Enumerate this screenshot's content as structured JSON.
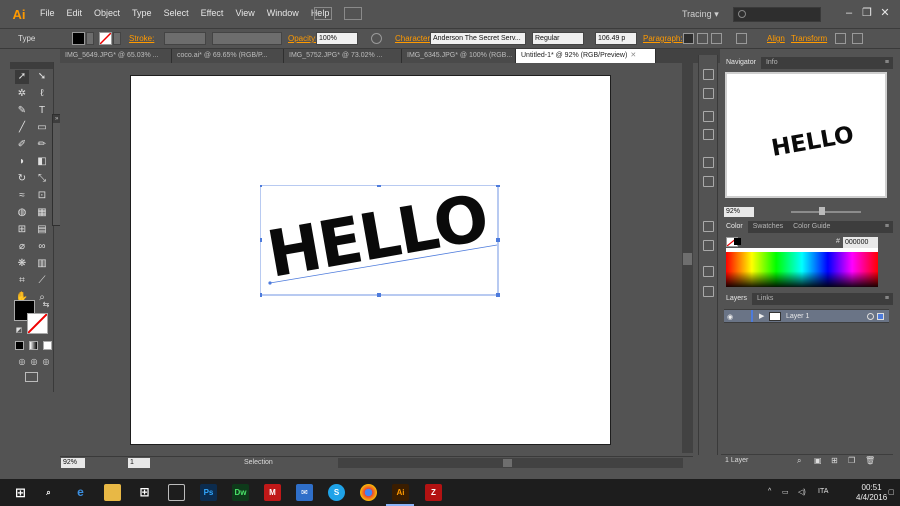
{
  "app": {
    "logo": "Ai"
  },
  "menu": [
    "File",
    "Edit",
    "Object",
    "Type",
    "Select",
    "Effect",
    "View",
    "Window",
    "Help"
  ],
  "workspace": {
    "label": "Tracing",
    "caret": "▾",
    "search_placeholder": ""
  },
  "window_controls": {
    "minimize": "–",
    "maximize": "❐",
    "close": "✕"
  },
  "control_bar": {
    "mode": "Type",
    "stroke_label": "Stroke:",
    "opacity_label": "Opacity:",
    "opacity_value": "100%",
    "character_label": "Character:",
    "font_name": "Anderson The Secret Serv...",
    "font_style": "Regular",
    "font_size": "106.49 p",
    "paragraph_label": "Paragraph:",
    "align_label": "Align",
    "transform_label": "Transform"
  },
  "tabs": [
    {
      "label": "IMG_5649.JPG* @ 65.03% ...",
      "active": false
    },
    {
      "label": "coco.ai* @ 69.65% (RGB/P...",
      "active": false
    },
    {
      "label": "IMG_5752.JPG* @ 73.02% ...",
      "active": false
    },
    {
      "label": "IMG_6345.JPG* @ 100% (RGB...",
      "active": false
    },
    {
      "label": "Untitled-1* @ 92% (RGB/Preview)",
      "active": true
    }
  ],
  "artwork": {
    "text": "HΕLLO",
    "color": "#0a0a0a"
  },
  "status": {
    "zoom": "92%",
    "page": "1",
    "tool": "Selection"
  },
  "navigator": {
    "tabs": [
      "Navigator",
      "Info"
    ],
    "zoom": "92%",
    "preview_text": "HΕLLO"
  },
  "color_panel": {
    "tabs": [
      "Color",
      "Swatches",
      "Color Guide"
    ],
    "hex_prefix": "#",
    "hex": "000000"
  },
  "layers_panel": {
    "tabs": [
      "Layers",
      "Links"
    ],
    "layer_name": "Layer 1",
    "count": "1 Layer"
  },
  "taskbar": {
    "language": "ITA",
    "time": "00:51",
    "date": "4/4/2016",
    "icons": [
      "windows-icon",
      "search-icon",
      "edge-icon",
      "file-explorer-icon",
      "store-icon",
      "photos-icon",
      "photoshop-icon",
      "dreamweaver-icon",
      "mcafee-icon",
      "outlook-icon",
      "skype-icon",
      "chrome-icon",
      "illustrator-icon",
      "filezilla-icon"
    ]
  },
  "colors": {
    "accent": "#ff9a00",
    "selection": "#4d7bdc",
    "ui_bg": "#535353"
  }
}
